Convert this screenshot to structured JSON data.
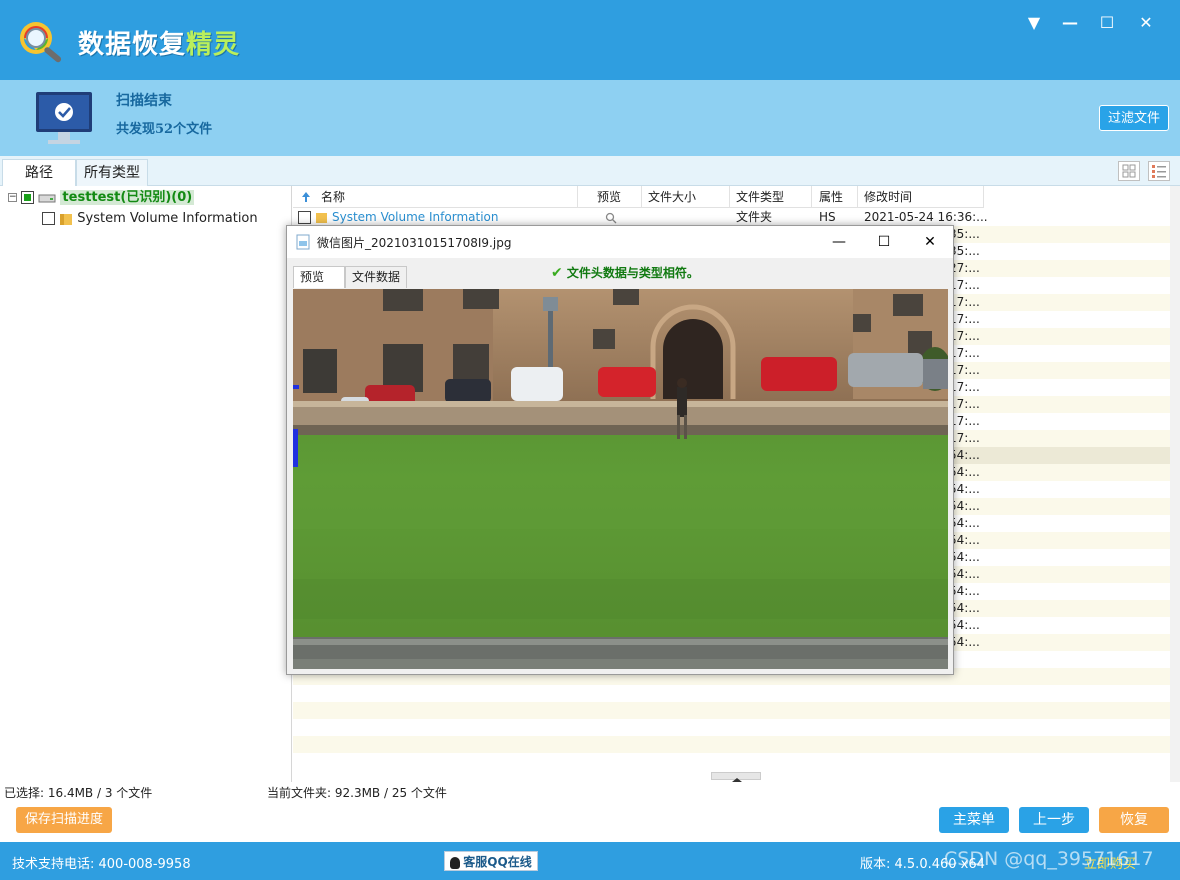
{
  "app": {
    "title_main": "数据恢复",
    "title_accent": "精灵"
  },
  "header": {
    "scan_title": "扫描结束",
    "scan_summary": "共发现52个文件",
    "filter_button": "过滤文件"
  },
  "tabs": {
    "path": "路径",
    "all_types": "所有类型"
  },
  "tree": {
    "root": "testtest(已识别)(0)",
    "child": "System Volume Information"
  },
  "list": {
    "columns": [
      "名称",
      "预览",
      "文件大小",
      "文件类型",
      "属性",
      "修改时间"
    ],
    "first_row": {
      "name": "System Volume Information",
      "type": "文件夹",
      "attr": "HS",
      "modified": "2021-05-24 16:36:..."
    },
    "time_suffixes": [
      "35:...",
      "35:...",
      "27:...",
      "17:...",
      "17:...",
      "17:...",
      "17:...",
      "17:...",
      "17:...",
      "17:...",
      "17:...",
      "17:...",
      "17:...",
      "54:...",
      "54:...",
      "54:...",
      "54:...",
      "54:...",
      "54:...",
      "54:...",
      "54:...",
      "54:...",
      "54:...",
      "54:...",
      "54:..."
    ]
  },
  "status": {
    "selected": "已选择: 16.4MB / 3 个文件",
    "current_folder": "当前文件夹: 92.3MB / 25 个文件"
  },
  "buttons": {
    "save_progress": "保存扫描进度",
    "main_menu": "主菜单",
    "prev_step": "上一步",
    "recover": "恢复"
  },
  "footer": {
    "support": "技术支持电话: 400-008-9958",
    "qq": "客服QQ在线",
    "version": "版本: 4.5.0.460 x64",
    "activate": "立即购买",
    "watermark": "CSDN @qq_39571617"
  },
  "dialog": {
    "title": "微信图片_20210310151708I9.jpg",
    "tab_preview": "预览",
    "tab_filedata": "文件数据",
    "message": "文件头数据与类型相符。"
  },
  "colors": {
    "primary": "#2f9ee0",
    "header": "#8ed0f2",
    "orange": "#f7a646",
    "button_blue": "#2aa2e6"
  }
}
